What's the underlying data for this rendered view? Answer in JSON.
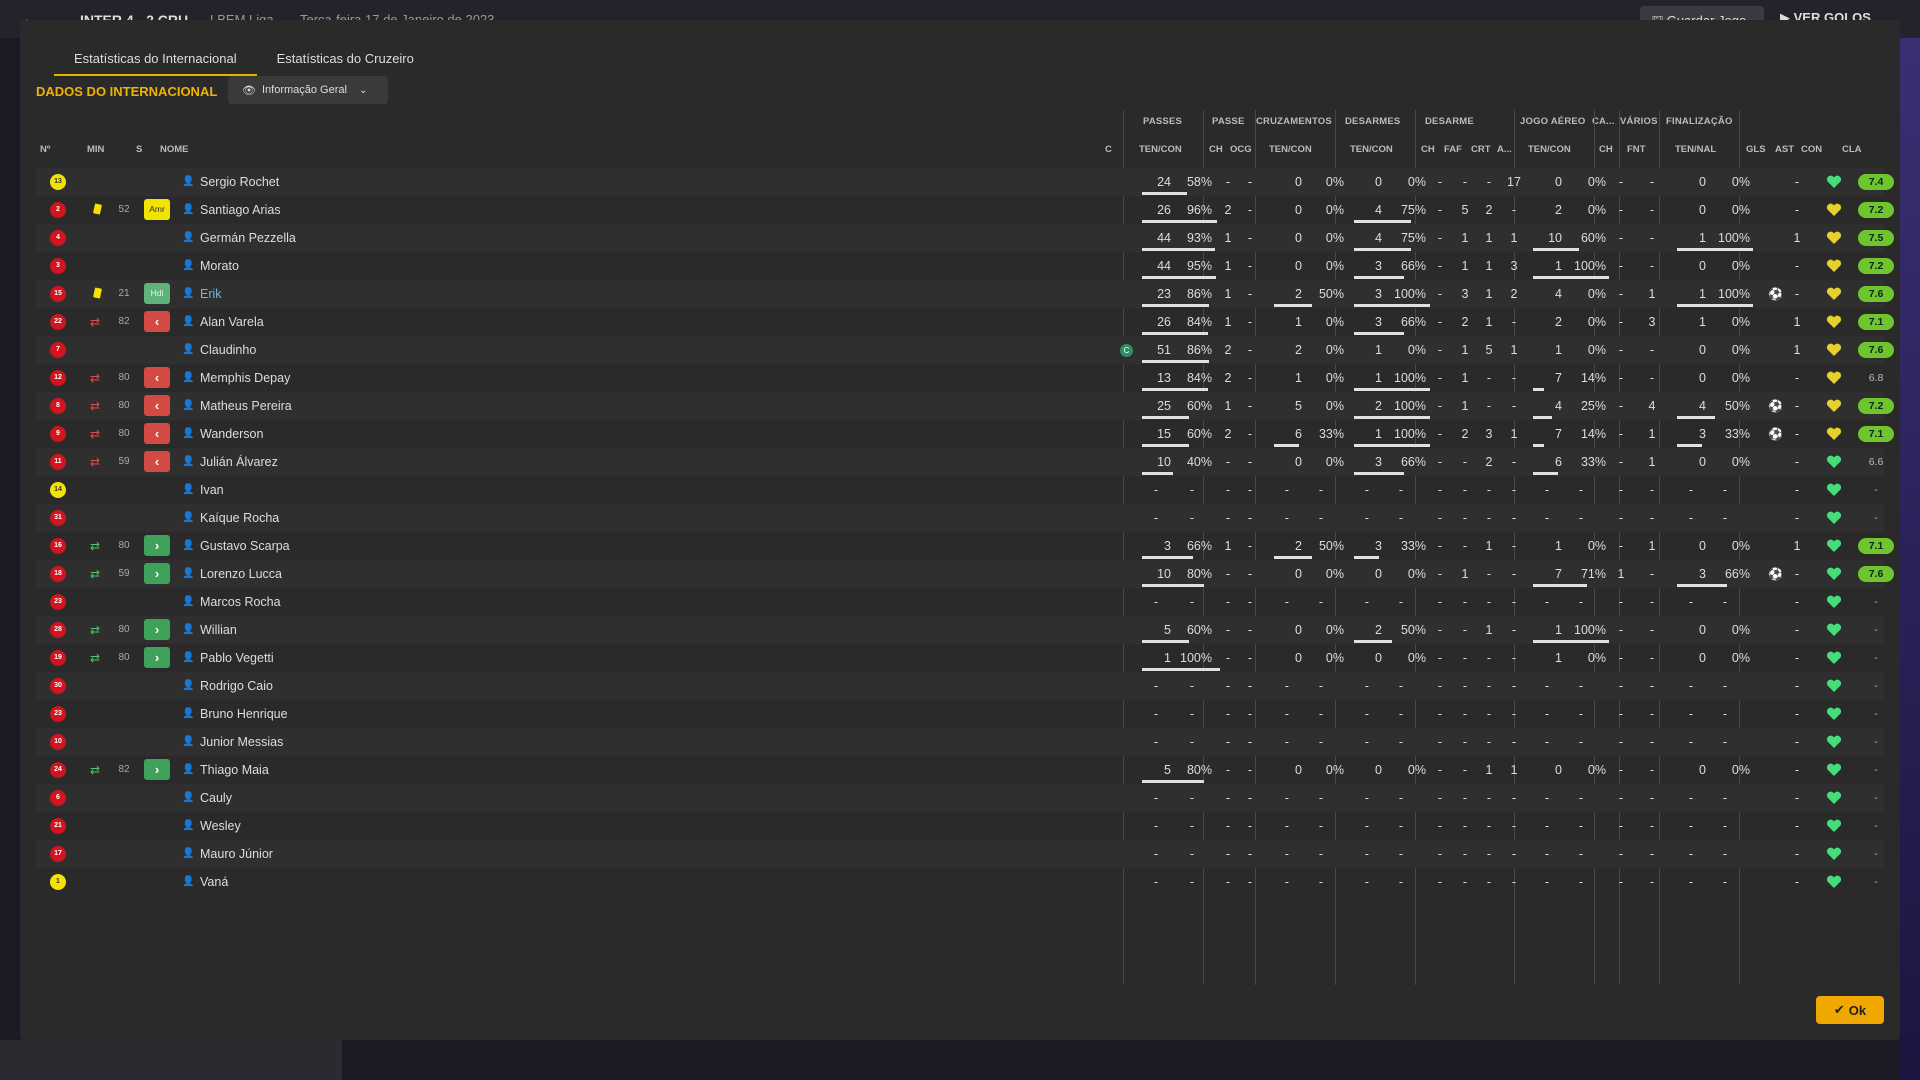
{
  "background": {
    "score": "INTER 4 - 2 CRU",
    "league": "LBEM Liga",
    "date": "Terça-feira 17 de Janeiro de 2023",
    "save_label": "Guardar Jogo",
    "see_goals_label": "VER GOLOS"
  },
  "tabs": [
    "Estatísticas do Internacional",
    "Estatísticas do Cruzeiro"
  ],
  "section_title": "DADOS DO INTERNACIONAL",
  "view_select": "Informação Geral",
  "groups": {
    "passes": "PASSES",
    "passe": "PASSE",
    "cruzamentos": "CRUZAMENTOS",
    "desarmes": "DESARMES",
    "desarme": "DESARME",
    "jogo_aereo": "JOGO AÉREO",
    "ca": "CA...",
    "varios": "VÁRIOS",
    "finalizacao": "FINALIZAÇÃO"
  },
  "columns": {
    "num": "Nº",
    "min": "MIN",
    "s": "S",
    "nome": "NOME",
    "c": "C",
    "passes_tc": "TEN/CON",
    "ch1": "CH",
    "ocg": "OCG",
    "cruz_tc": "TEN/CON",
    "des_tc": "TEN/CON",
    "ch2": "CH",
    "faf": "FAF",
    "crt": "CRT",
    "a": "A...",
    "aer_tc": "TEN/CON",
    "ch3": "CH",
    "fnt": "FNT",
    "fin_tn": "TEN/NAL",
    "gls": "GLS",
    "ast": "AST",
    "con": "CON",
    "cla": "CLA"
  },
  "players": [
    {
      "num": "13",
      "shirt": "yellow",
      "card": "",
      "sub": "",
      "min": "",
      "pos": "",
      "name": "Sergio Rochet",
      "cap": false,
      "pt": "24",
      "pp": "58%",
      "pb": 0.58,
      "ch": "-",
      "ocg": "-",
      "ct": "0",
      "cp": "0%",
      "cb": 0,
      "dt": "0",
      "dp": "0%",
      "db": 0,
      "dch": "-",
      "faf": "-",
      "crt": "-",
      "a": "17",
      "at": "0",
      "ap": "0%",
      "ab": 0,
      "ach": "-",
      "fnt": "-",
      "ft": "0",
      "fp": "0%",
      "fb": 0,
      "gls": "",
      "ast": "-",
      "heart": "green",
      "rating": "7.4",
      "rtype": "g"
    },
    {
      "num": "2",
      "shirt": "red",
      "card": "y",
      "sub": "",
      "min": "52",
      "pos": "Amr",
      "name": "Santiago Arias",
      "cap": false,
      "pt": "26",
      "pp": "96%",
      "pb": 0.96,
      "ch": "2",
      "ocg": "-",
      "ct": "0",
      "cp": "0%",
      "cb": 0,
      "dt": "4",
      "dp": "75%",
      "db": 0.75,
      "dch": "-",
      "faf": "5",
      "crt": "2",
      "a": "-",
      "at": "2",
      "ap": "0%",
      "ab": 0,
      "ach": "-",
      "fnt": "-",
      "ft": "0",
      "fp": "0%",
      "fb": 0,
      "gls": "",
      "ast": "-",
      "heart": "yellow",
      "rating": "7.2",
      "rtype": "g"
    },
    {
      "num": "4",
      "shirt": "red",
      "card": "",
      "sub": "",
      "min": "",
      "pos": "",
      "name": "Germán Pezzella",
      "cap": false,
      "pt": "44",
      "pp": "93%",
      "pb": 0.93,
      "ch": "1",
      "ocg": "-",
      "ct": "0",
      "cp": "0%",
      "cb": 0,
      "dt": "4",
      "dp": "75%",
      "db": 0.75,
      "dch": "-",
      "faf": "1",
      "crt": "1",
      "a": "1",
      "at": "10",
      "ap": "60%",
      "ab": 0.6,
      "ach": "-",
      "fnt": "-",
      "ft": "1",
      "fp": "100%",
      "fb": 1,
      "gls": "",
      "ast": "1",
      "heart": "yellow",
      "rating": "7.5",
      "rtype": "g"
    },
    {
      "num": "3",
      "shirt": "red",
      "card": "",
      "sub": "",
      "min": "",
      "pos": "",
      "name": "Morato",
      "cap": false,
      "pt": "44",
      "pp": "95%",
      "pb": 0.95,
      "ch": "1",
      "ocg": "-",
      "ct": "0",
      "cp": "0%",
      "cb": 0,
      "dt": "3",
      "dp": "66%",
      "db": 0.66,
      "dch": "-",
      "faf": "1",
      "crt": "1",
      "a": "3",
      "at": "1",
      "ap": "100%",
      "ab": 1,
      "ach": "-",
      "fnt": "-",
      "ft": "0",
      "fp": "0%",
      "fb": 0,
      "gls": "",
      "ast": "-",
      "heart": "yellow",
      "rating": "7.2",
      "rtype": "g"
    },
    {
      "num": "15",
      "shirt": "red",
      "card": "y",
      "sub": "",
      "min": "21",
      "pos": "Hdl",
      "name": "Erik",
      "cap": false,
      "link": true,
      "pt": "23",
      "pp": "86%",
      "pb": 0.86,
      "ch": "1",
      "ocg": "-",
      "ct": "2",
      "cp": "50%",
      "cb": 0.5,
      "dt": "3",
      "dp": "100%",
      "db": 1,
      "dch": "-",
      "faf": "3",
      "crt": "1",
      "a": "2",
      "at": "4",
      "ap": "0%",
      "ab": 0,
      "ach": "-",
      "fnt": "1",
      "ft": "1",
      "fp": "100%",
      "fb": 1,
      "gls": "cog",
      "ast": "-",
      "heart": "yellow",
      "rating": "7.6",
      "rtype": "g"
    },
    {
      "num": "22",
      "shirt": "red",
      "card": "",
      "sub": "out",
      "min": "82",
      "pos": "out",
      "name": "Alan Varela",
      "cap": false,
      "pt": "26",
      "pp": "84%",
      "pb": 0.84,
      "ch": "1",
      "ocg": "-",
      "ct": "1",
      "cp": "0%",
      "cb": 0,
      "dt": "3",
      "dp": "66%",
      "db": 0.66,
      "dch": "-",
      "faf": "2",
      "crt": "1",
      "a": "-",
      "at": "2",
      "ap": "0%",
      "ab": 0,
      "ach": "-",
      "fnt": "3",
      "ft": "1",
      "fp": "0%",
      "fb": 0,
      "gls": "",
      "ast": "1",
      "heart": "yellow",
      "rating": "7.1",
      "rtype": "g"
    },
    {
      "num": "7",
      "shirt": "red",
      "card": "",
      "sub": "",
      "min": "",
      "pos": "",
      "name": "Claudinho",
      "cap": true,
      "pt": "51",
      "pp": "86%",
      "pb": 0.86,
      "ch": "2",
      "ocg": "-",
      "ct": "2",
      "cp": "0%",
      "cb": 0,
      "dt": "1",
      "dp": "0%",
      "db": 0,
      "dch": "-",
      "faf": "1",
      "crt": "5",
      "a": "1",
      "at": "1",
      "ap": "0%",
      "ab": 0,
      "ach": "-",
      "fnt": "-",
      "ft": "0",
      "fp": "0%",
      "fb": 0,
      "gls": "",
      "ast": "1",
      "heart": "yellow",
      "rating": "7.6",
      "rtype": "g"
    },
    {
      "num": "12",
      "shirt": "red",
      "card": "",
      "sub": "out",
      "min": "80",
      "pos": "out",
      "name": "Memphis Depay",
      "cap": false,
      "pt": "13",
      "pp": "84%",
      "pb": 0.84,
      "ch": "2",
      "ocg": "-",
      "ct": "1",
      "cp": "0%",
      "cb": 0,
      "dt": "1",
      "dp": "100%",
      "db": 1,
      "dch": "-",
      "faf": "1",
      "crt": "-",
      "a": "-",
      "at": "7",
      "ap": "14%",
      "ab": 0.14,
      "ach": "-",
      "fnt": "-",
      "ft": "0",
      "fp": "0%",
      "fb": 0,
      "gls": "",
      "ast": "-",
      "heart": "yellow",
      "rating": "6.8",
      "rtype": "none"
    },
    {
      "num": "8",
      "shirt": "red",
      "card": "",
      "sub": "out",
      "min": "80",
      "pos": "out",
      "name": "Matheus Pereira",
      "cap": false,
      "pt": "25",
      "pp": "60%",
      "pb": 0.6,
      "ch": "1",
      "ocg": "-",
      "ct": "5",
      "cp": "0%",
      "cb": 0,
      "dt": "2",
      "dp": "100%",
      "db": 1,
      "dch": "-",
      "faf": "1",
      "crt": "-",
      "a": "-",
      "at": "4",
      "ap": "25%",
      "ab": 0.25,
      "ach": "-",
      "fnt": "4",
      "ft": "4",
      "fp": "50%",
      "fb": 0.5,
      "gls": "cog",
      "ast": "-",
      "heart": "yellow",
      "rating": "7.2",
      "rtype": "g"
    },
    {
      "num": "9",
      "shirt": "red",
      "card": "",
      "sub": "out",
      "min": "80",
      "pos": "out",
      "name": "Wanderson",
      "cap": false,
      "pt": "15",
      "pp": "60%",
      "pb": 0.6,
      "ch": "2",
      "ocg": "-",
      "ct": "6",
      "cp": "33%",
      "cb": 0.33,
      "dt": "1",
      "dp": "100%",
      "db": 1,
      "dch": "-",
      "faf": "2",
      "crt": "3",
      "a": "1",
      "at": "7",
      "ap": "14%",
      "ab": 0.14,
      "ach": "-",
      "fnt": "1",
      "ft": "3",
      "fp": "33%",
      "fb": 0.33,
      "gls": "cog",
      "ast": "-",
      "heart": "yellow",
      "rating": "7.1",
      "rtype": "g"
    },
    {
      "num": "11",
      "shirt": "red",
      "card": "",
      "sub": "out",
      "min": "59",
      "pos": "out",
      "name": "Julián Álvarez",
      "cap": false,
      "pt": "10",
      "pp": "40%",
      "pb": 0.4,
      "ch": "-",
      "ocg": "-",
      "ct": "0",
      "cp": "0%",
      "cb": 0,
      "dt": "3",
      "dp": "66%",
      "db": 0.66,
      "dch": "-",
      "faf": "-",
      "crt": "2",
      "a": "-",
      "at": "6",
      "ap": "33%",
      "ab": 0.33,
      "ach": "-",
      "fnt": "1",
      "ft": "0",
      "fp": "0%",
      "fb": 0,
      "gls": "",
      "ast": "-",
      "heart": "green",
      "rating": "6.6",
      "rtype": "none"
    },
    {
      "num": "14",
      "shirt": "yellow",
      "card": "",
      "sub": "",
      "min": "",
      "pos": "",
      "name": "Ivan",
      "cap": false,
      "empty": true,
      "heart": "green",
      "rating": "-",
      "rtype": "none"
    },
    {
      "num": "31",
      "shirt": "red",
      "card": "",
      "sub": "",
      "min": "",
      "pos": "",
      "name": "Kaíque Rocha",
      "cap": false,
      "empty": true,
      "heart": "green",
      "rating": "-",
      "rtype": "none"
    },
    {
      "num": "16",
      "shirt": "red",
      "card": "",
      "sub": "in",
      "min": "80",
      "pos": "in",
      "name": "Gustavo Scarpa",
      "cap": false,
      "pt": "3",
      "pp": "66%",
      "pb": 0.66,
      "ch": "1",
      "ocg": "-",
      "ct": "2",
      "cp": "50%",
      "cb": 0.5,
      "dt": "3",
      "dp": "33%",
      "db": 0.33,
      "dch": "-",
      "faf": "-",
      "crt": "1",
      "a": "-",
      "at": "1",
      "ap": "0%",
      "ab": 0,
      "ach": "-",
      "fnt": "1",
      "ft": "0",
      "fp": "0%",
      "fb": 0,
      "gls": "",
      "ast": "1",
      "heart": "green",
      "rating": "7.1",
      "rtype": "g"
    },
    {
      "num": "18",
      "shirt": "red",
      "card": "",
      "sub": "in",
      "min": "59",
      "pos": "in",
      "name": "Lorenzo Lucca",
      "cap": false,
      "pt": "10",
      "pp": "80%",
      "pb": 0.8,
      "ch": "-",
      "ocg": "-",
      "ct": "0",
      "cp": "0%",
      "cb": 0,
      "dt": "0",
      "dp": "0%",
      "db": 0,
      "dch": "-",
      "faf": "1",
      "crt": "-",
      "a": "-",
      "at": "7",
      "ap": "71%",
      "ab": 0.71,
      "ach": "1",
      "fnt": "-",
      "ft": "3",
      "fp": "66%",
      "fb": 0.66,
      "gls": "cog",
      "ast": "-",
      "heart": "green",
      "rating": "7.6",
      "rtype": "g"
    },
    {
      "num": "23",
      "shirt": "red",
      "card": "",
      "sub": "",
      "min": "",
      "pos": "",
      "name": "Marcos Rocha",
      "cap": false,
      "empty": true,
      "heart": "green",
      "rating": "-",
      "rtype": "none"
    },
    {
      "num": "28",
      "shirt": "red",
      "card": "",
      "sub": "in",
      "min": "80",
      "pos": "in",
      "name": "Willian",
      "cap": false,
      "pt": "5",
      "pp": "60%",
      "pb": 0.6,
      "ch": "-",
      "ocg": "-",
      "ct": "0",
      "cp": "0%",
      "cb": 0,
      "dt": "2",
      "dp": "50%",
      "db": 0.5,
      "dch": "-",
      "faf": "-",
      "crt": "1",
      "a": "-",
      "at": "1",
      "ap": "100%",
      "ab": 1,
      "ach": "-",
      "fnt": "-",
      "ft": "0",
      "fp": "0%",
      "fb": 0,
      "gls": "",
      "ast": "-",
      "heart": "green",
      "rating": "-",
      "rtype": "none"
    },
    {
      "num": "19",
      "shirt": "red",
      "card": "",
      "sub": "in",
      "min": "80",
      "pos": "in",
      "name": "Pablo Vegetti",
      "cap": false,
      "pt": "1",
      "pp": "100%",
      "pb": 1,
      "ch": "-",
      "ocg": "-",
      "ct": "0",
      "cp": "0%",
      "cb": 0,
      "dt": "0",
      "dp": "0%",
      "db": 0,
      "dch": "-",
      "faf": "-",
      "crt": "-",
      "a": "-",
      "at": "1",
      "ap": "0%",
      "ab": 0,
      "ach": "-",
      "fnt": "-",
      "ft": "0",
      "fp": "0%",
      "fb": 0,
      "gls": "",
      "ast": "-",
      "heart": "green",
      "rating": "-",
      "rtype": "none"
    },
    {
      "num": "30",
      "shirt": "red",
      "card": "",
      "sub": "",
      "min": "",
      "pos": "",
      "name": "Rodrigo Caio",
      "cap": false,
      "empty": true,
      "heart": "green",
      "rating": "-",
      "rtype": "none"
    },
    {
      "num": "23",
      "shirt": "red",
      "card": "",
      "sub": "",
      "min": "",
      "pos": "",
      "name": "Bruno Henrique",
      "cap": false,
      "empty": true,
      "heart": "green",
      "rating": "-",
      "rtype": "none"
    },
    {
      "num": "10",
      "shirt": "red",
      "card": "",
      "sub": "",
      "min": "",
      "pos": "",
      "name": "Junior Messias",
      "cap": false,
      "empty": true,
      "heart": "green",
      "rating": "-",
      "rtype": "none"
    },
    {
      "num": "24",
      "shirt": "red",
      "card": "",
      "sub": "in",
      "min": "82",
      "pos": "in",
      "name": "Thiago Maia",
      "cap": false,
      "pt": "5",
      "pp": "80%",
      "pb": 0.8,
      "ch": "-",
      "ocg": "-",
      "ct": "0",
      "cp": "0%",
      "cb": 0,
      "dt": "0",
      "dp": "0%",
      "db": 0,
      "dch": "-",
      "faf": "-",
      "crt": "1",
      "a": "1",
      "at": "0",
      "ap": "0%",
      "ab": 0,
      "ach": "-",
      "fnt": "-",
      "ft": "0",
      "fp": "0%",
      "fb": 0,
      "gls": "",
      "ast": "-",
      "heart": "green",
      "rating": "-",
      "rtype": "none"
    },
    {
      "num": "6",
      "shirt": "red",
      "card": "",
      "sub": "",
      "min": "",
      "pos": "",
      "name": "Cauly",
      "cap": false,
      "empty": true,
      "heart": "green",
      "rating": "-",
      "rtype": "none"
    },
    {
      "num": "21",
      "shirt": "red",
      "card": "",
      "sub": "",
      "min": "",
      "pos": "",
      "name": "Wesley",
      "cap": false,
      "empty": true,
      "heart": "green",
      "rating": "-",
      "rtype": "none"
    },
    {
      "num": "17",
      "shirt": "red",
      "card": "",
      "sub": "",
      "min": "",
      "pos": "",
      "name": "Mauro Júnior",
      "cap": false,
      "empty": true,
      "heart": "green",
      "rating": "-",
      "rtype": "none"
    },
    {
      "num": "1",
      "shirt": "yellow",
      "card": "",
      "sub": "",
      "min": "",
      "pos": "",
      "name": "Vaná",
      "cap": false,
      "empty": true,
      "heart": "green",
      "rating": "-",
      "rtype": "none"
    }
  ],
  "ok_label": "Ok",
  "colors": {
    "accent": "#f0b400",
    "rating_green": "#6ec52e",
    "sub_out": "#d14a43",
    "sub_in": "#3fa25a",
    "heart_green": "#44dd77",
    "heart_yellow": "#e8d030"
  }
}
